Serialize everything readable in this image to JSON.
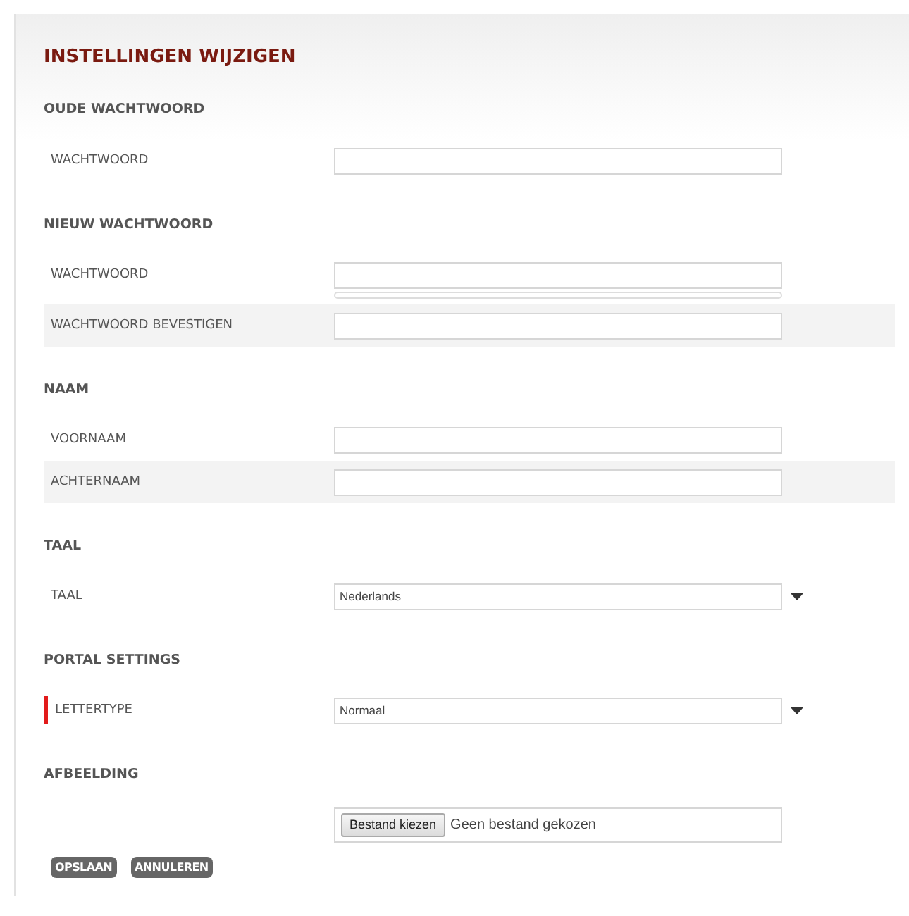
{
  "title": "INSTELLINGEN WIJZIGEN",
  "sections": [
    {
      "heading": "OUDE WACHTWOORD",
      "rows": [
        {
          "kind": "text",
          "label": "WACHTWOORD"
        }
      ]
    },
    {
      "heading": "NIEUW WACHTWOORD",
      "rows": [
        {
          "kind": "text",
          "label": "WACHTWOORD",
          "underbar": true
        },
        {
          "kind": "text",
          "label": "WACHTWOORD BEVESTIGEN"
        }
      ]
    },
    {
      "heading": "NAAM",
      "rows": [
        {
          "kind": "text",
          "label": "VOORNAAM"
        },
        {
          "kind": "text",
          "label": "ACHTERNAAM"
        }
      ]
    },
    {
      "heading": "TAAL",
      "rows": [
        {
          "kind": "select",
          "label": "TAAL",
          "value": "Nederlands"
        }
      ]
    },
    {
      "heading": "PORTAL SETTINGS",
      "rows": [
        {
          "kind": "select",
          "label": "LETTERTYPE",
          "value": "Normaal",
          "flagged": true
        }
      ]
    },
    {
      "heading": "AFBEELDING",
      "rows": [
        {
          "kind": "file",
          "button": "Bestand kiezen",
          "status": "Geen bestand gekozen"
        }
      ]
    }
  ],
  "buttons": [
    "OPSLAAN",
    "ANNULEREN"
  ]
}
